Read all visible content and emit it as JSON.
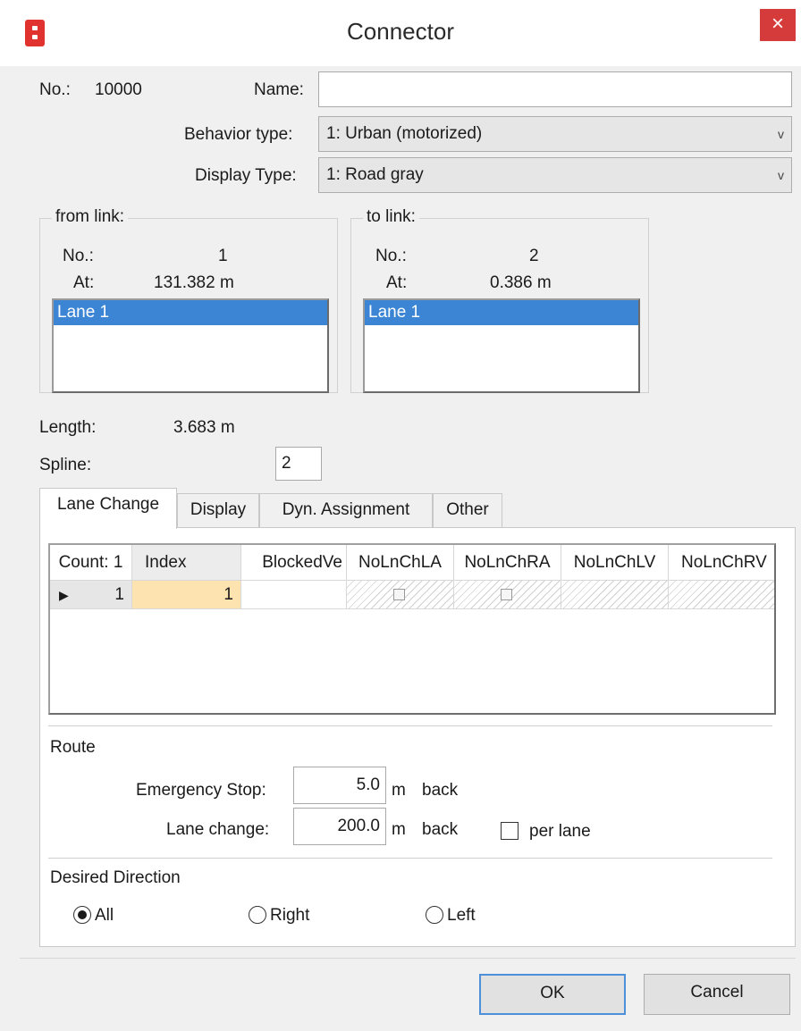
{
  "window": {
    "title": "Connector",
    "close_symbol": "×"
  },
  "header": {
    "no_label": "No.:",
    "no_value": "10000",
    "name_label": "Name:",
    "name_value": "",
    "behavior_label": "Behavior type:",
    "behavior_value": "1: Urban (motorized)",
    "display_label": "Display Type:",
    "display_value": "1: Road gray",
    "dropdown_arrow": "v"
  },
  "from_link": {
    "title": "from link:",
    "no_label": "No.:",
    "no_value": "1",
    "at_label": "At:",
    "at_value": "131.382 m",
    "lanes": [
      "Lane 1"
    ]
  },
  "to_link": {
    "title": "to link:",
    "no_label": "No.:",
    "no_value": "2",
    "at_label": "At:",
    "at_value": "0.386 m",
    "lanes": [
      "Lane 1"
    ]
  },
  "length": {
    "label": "Length:",
    "value": "3.683 m"
  },
  "spline": {
    "label": "Spline:",
    "value": "2"
  },
  "tabs": [
    "Lane Change",
    "Display",
    "Dyn. Assignment",
    "Other"
  ],
  "grid": {
    "columns": [
      "Count: 1",
      "Index",
      "BlockedVe",
      "NoLnChLA",
      "NoLnChRA",
      "NoLnChLV",
      "NoLnChRV"
    ],
    "row": {
      "marker": "▶",
      "count": "1",
      "index": "1"
    }
  },
  "route": {
    "title": "Route",
    "emergency_label": "Emergency Stop:",
    "emergency_value": "5.0",
    "emergency_unit": "m",
    "emergency_back": "back",
    "lanechange_label": "Lane change:",
    "lanechange_value": "200.0",
    "lanechange_unit": "m",
    "lanechange_back": "back",
    "per_lane_label": "per lane",
    "per_lane_checked": false
  },
  "desired_direction": {
    "title": "Desired Direction",
    "options": [
      "All",
      "Right",
      "Left"
    ],
    "selected": "All"
  },
  "buttons": {
    "ok": "OK",
    "cancel": "Cancel"
  },
  "colors": {
    "selection": "#3b85d4",
    "close": "#d63b3b",
    "index_cell": "#fce3b0",
    "app_icon": "#e0322f"
  }
}
